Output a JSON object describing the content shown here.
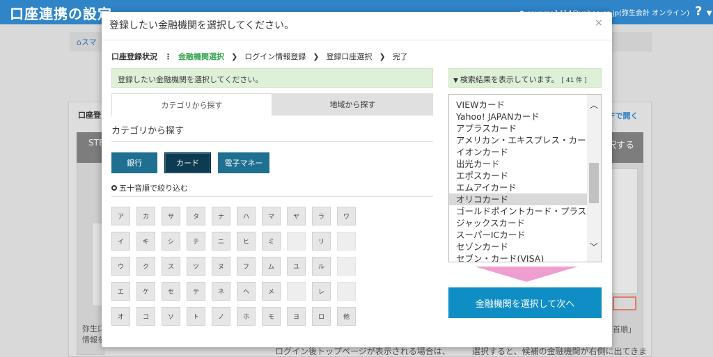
{
  "background": {
    "page_title": "口座連携の設定",
    "account": "sayama1414@yahoo.co.jp(弥生会計 オンライン)",
    "help_icon": "?",
    "help_caret": "▼",
    "breadcrumb": "スマ",
    "left_panel_title": "口座登",
    "left_card_head": "STE",
    "pdf_link": "Fで開く",
    "right_card_head": "択する",
    "left_foot_1": "弥生口",
    "left_foot_2": "情報を",
    "right_foot": "首順」",
    "foot_a": "ログイン後トップページが表示される場合は、",
    "foot_b": "選択すると、候補の金融機関が右側に出てきま"
  },
  "modal": {
    "title": "登録したい金融機関を選択してください。",
    "close": "×",
    "steps": {
      "label": "口座登録状況",
      "items": [
        "金融機関選択",
        "ログイン情報登録",
        "登録口座選択",
        "完了"
      ]
    },
    "info": "登録したい金融機関を選択してください。",
    "tabs": [
      "カテゴリから探す",
      "地域から探す"
    ],
    "section_title": "カテゴリから探す",
    "category_buttons": [
      "銀行",
      "カード",
      "電子マネー"
    ],
    "filter_label": "五十音順で絞り込む",
    "kana_rows": [
      [
        "ア",
        "カ",
        "サ",
        "タ",
        "ナ",
        "ハ",
        "マ",
        "ヤ",
        "ラ",
        "ワ"
      ],
      [
        "イ",
        "キ",
        "シ",
        "チ",
        "ニ",
        "ヒ",
        "ミ",
        "",
        "リ",
        ""
      ],
      [
        "ウ",
        "ク",
        "ス",
        "ツ",
        "ヌ",
        "フ",
        "ム",
        "ユ",
        "ル",
        ""
      ],
      [
        "エ",
        "ケ",
        "セ",
        "テ",
        "ネ",
        "ヘ",
        "メ",
        "",
        "レ",
        ""
      ],
      [
        "オ",
        "コ",
        "ソ",
        "ト",
        "ノ",
        "ホ",
        "モ",
        "ヨ",
        "ロ",
        "他"
      ]
    ],
    "result": {
      "text": "検索結果を表示しています。",
      "count": "[ 41 件 ]",
      "chevron": "❯"
    },
    "list": [
      "VIEWカード",
      "Yahoo! JAPANカード",
      "アプラスカード",
      "アメリカン・エキスプレス・カード",
      "イオンカード",
      "出光カード",
      "エポスカード",
      "エムアイカード",
      "オリコカード",
      "ゴールドポイントカード・プラス",
      "ジャックスカード",
      "スーパーICカード",
      "セゾンカード",
      "セブン・カード(VISA)"
    ],
    "selected_item": "オリコカード",
    "scroll_up": "︿",
    "scroll_down": "﹀",
    "next_button": "金融機関を選択して次へ",
    "colors": {
      "accent_green": "#3aa655",
      "category_button": "#1f6f91",
      "category_selected": "#0d3c52",
      "primary_button": "#0f8ec6",
      "arrow": "#ef9fcf",
      "banner": "#dff0d8"
    }
  }
}
